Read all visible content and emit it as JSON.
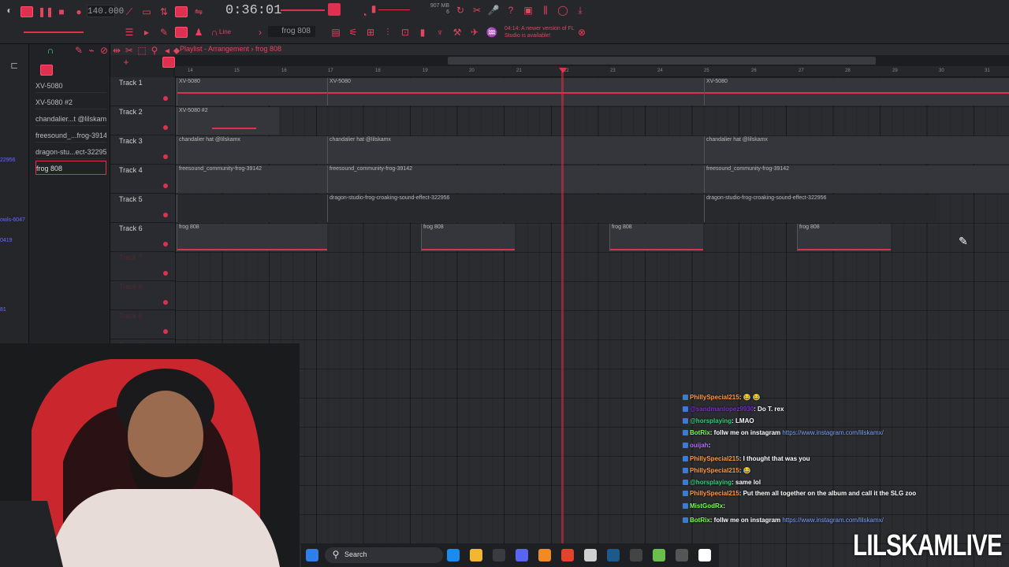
{
  "toolbar": {
    "tempo": "140.000",
    "time": "0:36:01",
    "cpu_line1": "907 MB",
    "cpu_line2": "6",
    "line_mode": "Line",
    "pattern": "frog 808",
    "notice": "04:14: A newer version of FL Studio is available!"
  },
  "playlist": {
    "title": "Playlist - Arrangement › frog 808",
    "ticks": [
      "14",
      "15",
      "16",
      "17",
      "18",
      "19",
      "20",
      "21",
      "22",
      "23",
      "24",
      "25",
      "26",
      "27",
      "28",
      "29",
      "30",
      "31"
    ]
  },
  "picker": {
    "items": [
      "XV-5080",
      "XV-5080 #2",
      "chandalier...t @lilskamx",
      "freesound_...frog-39142",
      "dragon-stu...ect-322956",
      "frog 808"
    ]
  },
  "browser_tags": [
    "22956",
    "owls-6047",
    "0419",
    "81"
  ],
  "tracks": [
    {
      "label": "Track 1"
    },
    {
      "label": "Track 2"
    },
    {
      "label": "Track 3"
    },
    {
      "label": "Track 4"
    },
    {
      "label": "Track 5"
    },
    {
      "label": "Track 6"
    },
    {
      "label": "Track 7"
    },
    {
      "label": "Track 8"
    },
    {
      "label": "Track 9"
    },
    {
      "label": "Track 10"
    }
  ],
  "clips": {
    "t1": "XV-5080",
    "t2": "XV-5080 #2",
    "t3": "chandalier hat @lilskamx",
    "t4": "freesound_community-frog-39142",
    "t5": "dragon-studio-frog-croaking-sound-effect-322956",
    "t6": "frog 808"
  },
  "chat": [
    {
      "user": "PhillySpecial215",
      "text": ": 😂 😂",
      "color": "#ff9b3d"
    },
    {
      "user": "@sandmanlopez9930",
      "text": ": Do T. rex",
      "color": "#7a2fd0"
    },
    {
      "user": "@horsplaying",
      "text": ": LMAO",
      "color": "#2fd07a"
    },
    {
      "user": "BotRix",
      "text": ": follw me on instagram ",
      "link": "https://www.instagram.com/lilskamx/",
      "color": "#7aff4a"
    },
    {
      "user": "ouijah",
      "text": ": ",
      "color": "#b86bff"
    },
    {
      "user": "PhillySpecial215",
      "text": ": I thought that was you",
      "color": "#ff9b3d"
    },
    {
      "user": "PhillySpecial215",
      "text": ": 😂",
      "color": "#ff9b3d"
    },
    {
      "user": "@horsplaying",
      "text": ": same lol",
      "color": "#2fd07a"
    },
    {
      "user": "PhillySpecial215",
      "text": ": Put them all together on the album and call it the SLG zoo",
      "color": "#ff9b3d"
    },
    {
      "user": "MistGodRx",
      "text": ": ",
      "color": "#7aff4a"
    },
    {
      "user": "BotRix",
      "text": ": follw me on instagram ",
      "link": "https://www.instagram.com/lilskamx/",
      "color": "#7aff4a"
    }
  ],
  "taskbar": {
    "search": "Search"
  },
  "overlay": {
    "brand": "LILSKAMLIVE"
  },
  "colors": {
    "accent": "#e0304f",
    "background": "#1c1d20"
  }
}
